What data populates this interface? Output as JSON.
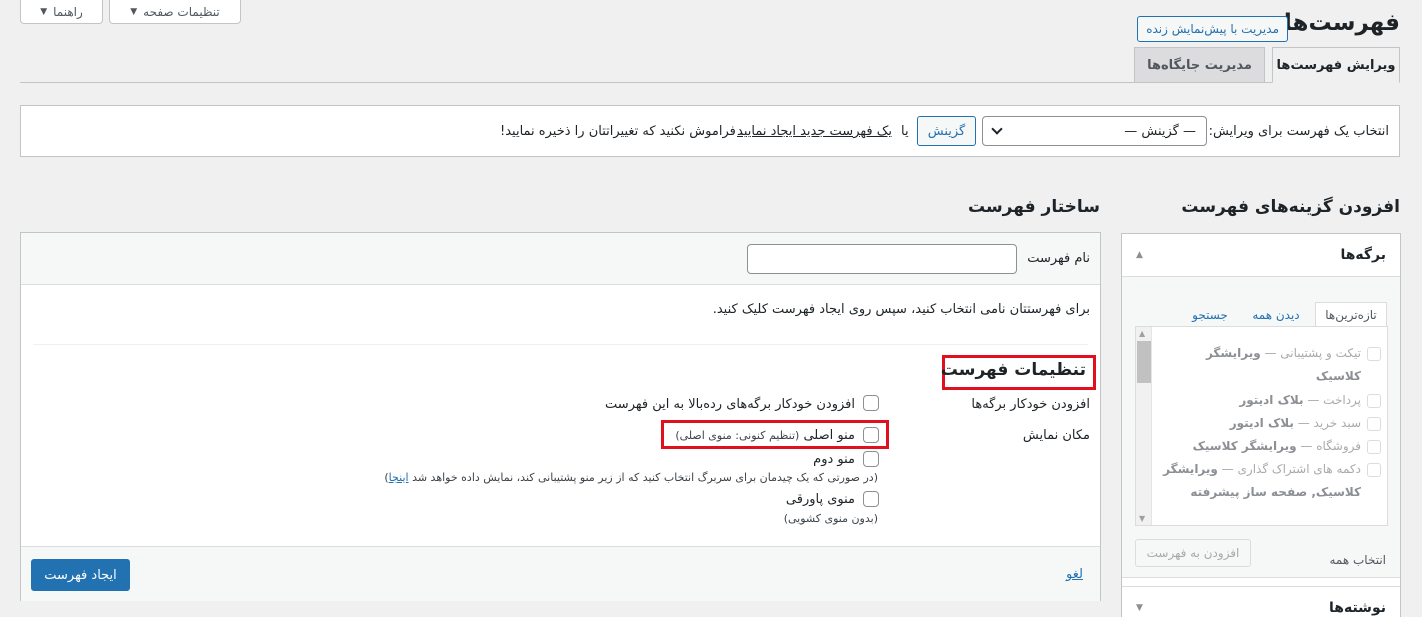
{
  "screen_meta": {
    "help_label": "راهنما",
    "screen_options_label": "تنظیمات صفحه"
  },
  "header": {
    "title": "فهرست‌ها",
    "live_preview_button": "مدیریت با پیش‌نمایش زنده"
  },
  "tabs": [
    {
      "label": "ویرایش فهرست‌ها",
      "active": true
    },
    {
      "label": "مدیریت جایگاه‌ها",
      "active": false
    }
  ],
  "manage_menus": {
    "label": "انتخاب یک فهرست برای ویرایش:",
    "select_value": "— گزینش —",
    "select_button": "گزینش",
    "or_text": "یا",
    "create_link": "یک فهرست جدید ایجاد نمایید",
    "reminder": ". فراموش نکنید که تغییراتتان را ذخیره نمایید!"
  },
  "sidebar": {
    "heading": "افزودن گزینه‌های فهرست",
    "pages_section": {
      "title": "برگه‌ها",
      "tabs": [
        "تازه‌ترین‌ها",
        "دیدن همه",
        "جستجو"
      ],
      "items": [
        {
          "name": "تیکت و پشتیبانی",
          "suffix": "ویرایشگر کلاسیک"
        },
        {
          "name": "پرداخت",
          "suffix": "بلاک ادیتور"
        },
        {
          "name": "سبد خرید",
          "suffix": "بلاک ادیتور"
        },
        {
          "name": "فروشگاه",
          "suffix": "ویرایشگر کلاسیک"
        },
        {
          "name": "دکمه های اشتراک گذاری",
          "suffix": "ویرایشگر کلاسیک, صفحه ساز پیشرفته"
        }
      ],
      "select_all": "انتخاب همه",
      "add_button": "افزودن به فهرست"
    },
    "posts_section": {
      "title": "نوشته‌ها"
    }
  },
  "menu_structure": {
    "heading": "ساختار فهرست",
    "name_label": "نام فهرست",
    "name_value": "",
    "instruction": "برای فهرستتان نامی انتخاب کنید، سپس روی ایجاد فهرست کلیک کنید.",
    "settings_heading": "تنظیمات فهرست",
    "auto_add_label": "افزودن خودکار برگه‌ها",
    "auto_add_option": "افزودن خودکار برگه‌های رده‌بالا به این فهرست",
    "display_location_label": "مکان نمایش",
    "locations": [
      {
        "name": "منو اصلی",
        "note": "(تنظیم کنونی: منوی اصلی)"
      },
      {
        "name": "منو دوم",
        "note": "(در صورتی که یک چیدمان برای سربرگ انتخاب کنید که از زیر منو پشتیبانی کند، نمایش داده خواهد شد",
        "note_link": "اینجا",
        "note_end": ")"
      },
      {
        "name": "منوی پاورقی",
        "note": "(بدون منوی کشویی)"
      }
    ],
    "create_button": "ایجاد فهرست",
    "cancel_link": "لغو"
  },
  "colors": {
    "accent": "#2271b1",
    "highlight_box": "#e0101e"
  }
}
